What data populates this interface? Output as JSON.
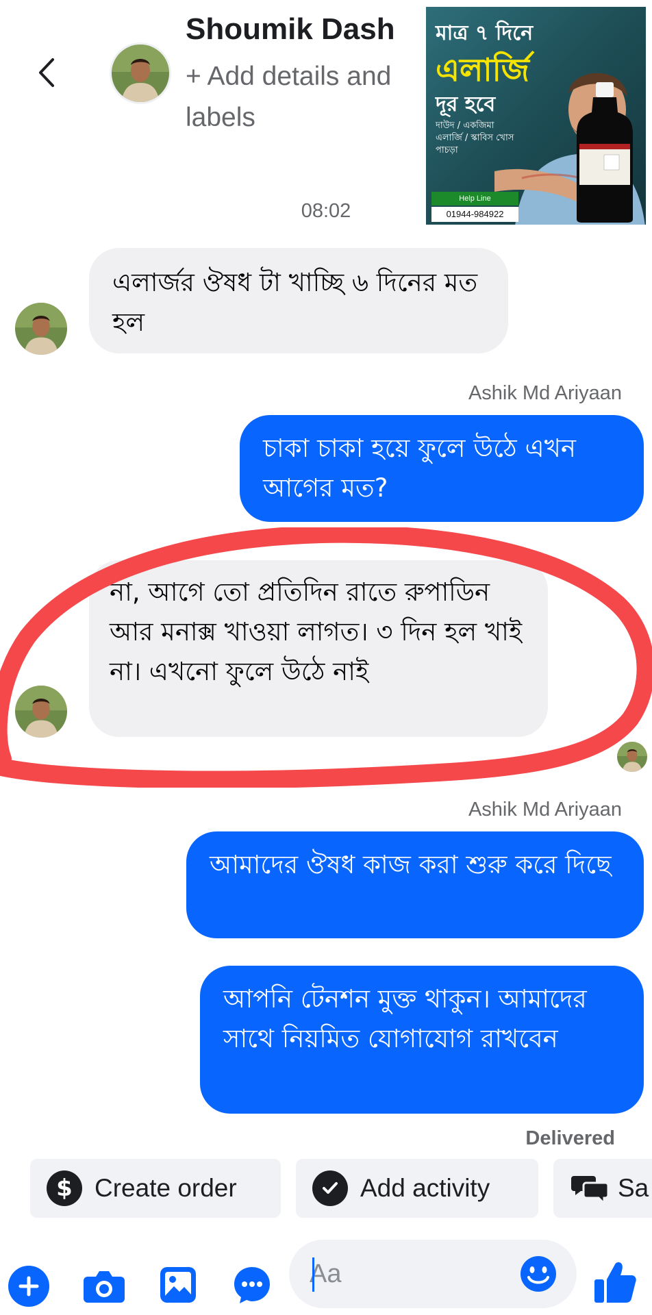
{
  "header": {
    "contact_name": "Shoumik Dash",
    "add_details": "+ Add details and labels"
  },
  "ad": {
    "line1": "মাত্র ৭ দিনে",
    "line2": "এলার্জি",
    "line3": "দূর হবে",
    "conditions": "দাউদ / একজিমা এলার্জি / স্কাবিস খোস পাচড়া",
    "helpline_label": "Help Line",
    "helpline_number": "01944-984922"
  },
  "conversation": {
    "timestamp": "08:02",
    "messages": [
      {
        "text": "এলার্জর ঔষধ টা খাচ্ছি ৬ দিনের মত হল"
      },
      {
        "sender": "Ashik Md Ariyaan",
        "text": "চাকা চাকা হয়ে ফুলে উঠে এখন আগের মত?"
      },
      {
        "text": "না, আগে তো প্রতিদিন রাতে রুপাডিন আর মনাক্স খাওয়া লাগত। ৩ দিন হল খাই না। এখনো ফুলে উঠে নাই"
      },
      {
        "sender": "Ashik Md Ariyaan",
        "text": "আমাদের ঔষধ কাজ করা শুরু করে দিছে"
      },
      {
        "text": "আপনি টেনশন মুক্ত থাকুন। আমাদের সাথে নিয়মিত যোগাযোগ রাখবেন"
      }
    ],
    "status": "Delivered"
  },
  "actions": {
    "create_order": "Create order",
    "add_activity": "Add activity",
    "third": "Sa"
  },
  "composer": {
    "placeholder": "Aa"
  },
  "colors": {
    "messenger_blue": "#0866ff",
    "incoming_bubble": "#f0f0f2",
    "annotation_red": "#f5484b"
  },
  "icons": [
    "back-chevron-icon",
    "plus-icon",
    "camera-icon",
    "gallery-icon",
    "chat-icon",
    "emoji-icon",
    "like-thumb-icon",
    "dollar-icon",
    "check-icon",
    "speech-bubbles-icon"
  ]
}
